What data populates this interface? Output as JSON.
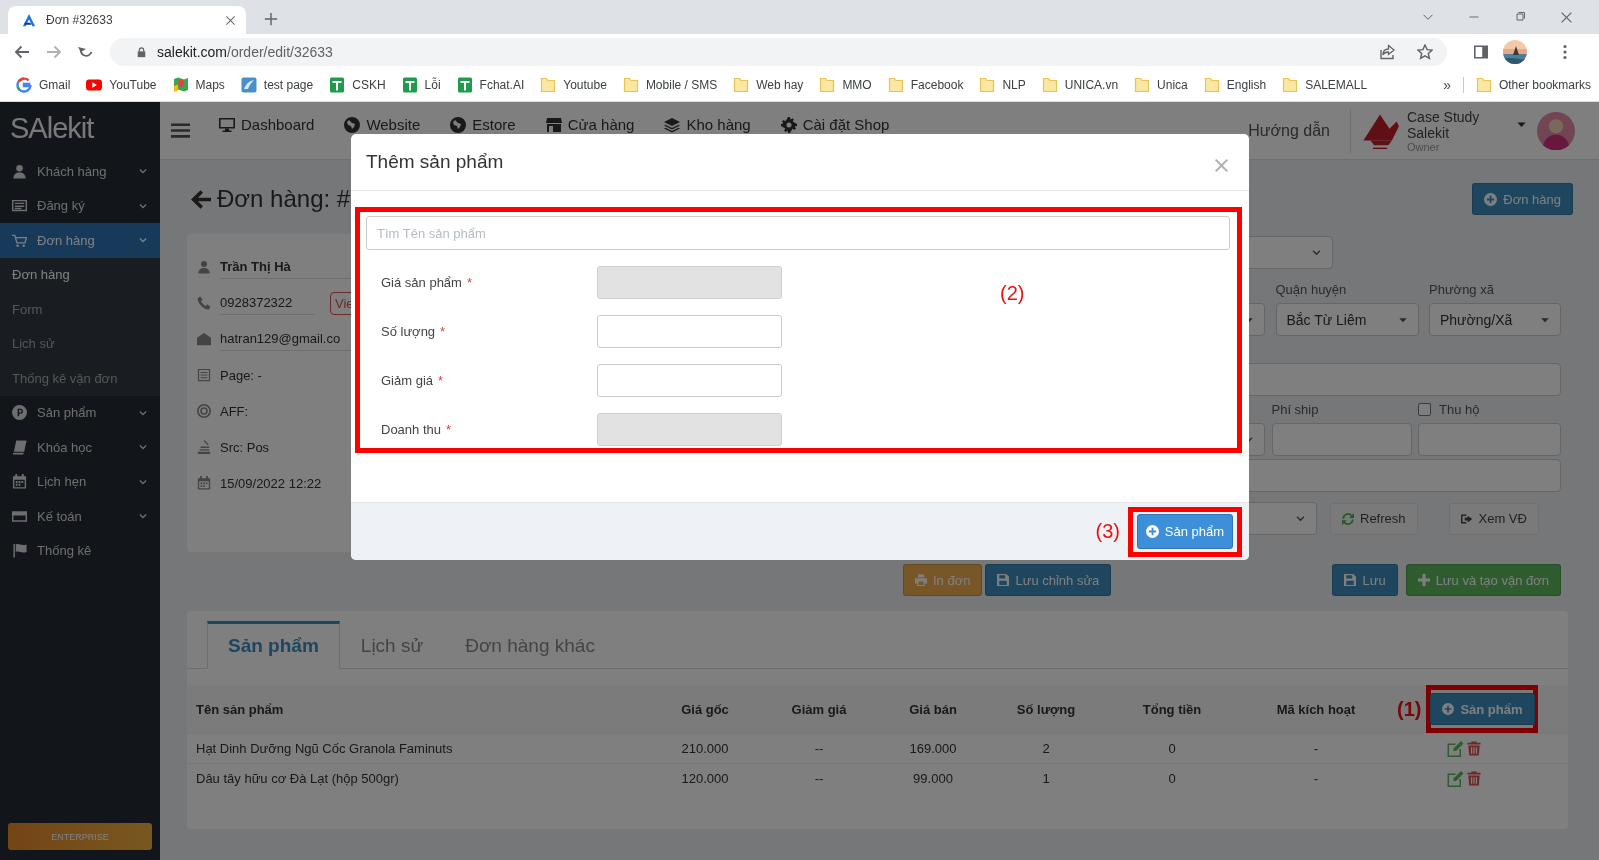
{
  "browser": {
    "tab_title": "Đơn #32633",
    "url_host": "salekit.com",
    "url_path": "/order/edit/32633",
    "bookmarks": [
      {
        "label": "Gmail",
        "kind": "gmail"
      },
      {
        "label": "YouTube",
        "kind": "youtube"
      },
      {
        "label": "Maps",
        "kind": "maps"
      },
      {
        "label": "test page",
        "kind": "site"
      },
      {
        "label": "CSKH",
        "kind": "sheet"
      },
      {
        "label": "Lỗi",
        "kind": "sheet"
      },
      {
        "label": "Fchat.AI",
        "kind": "sheet"
      },
      {
        "label": "Youtube",
        "kind": "folder"
      },
      {
        "label": "Mobile / SMS",
        "kind": "folder"
      },
      {
        "label": "Web hay",
        "kind": "folder"
      },
      {
        "label": "MMO",
        "kind": "folder"
      },
      {
        "label": "Facebook",
        "kind": "folder"
      },
      {
        "label": "NLP",
        "kind": "folder"
      },
      {
        "label": "UNICA.vn",
        "kind": "folder"
      },
      {
        "label": "Unica",
        "kind": "folder"
      },
      {
        "label": "English",
        "kind": "folder"
      },
      {
        "label": "SALEMALL",
        "kind": "folder"
      }
    ],
    "more": "»",
    "other_bookmarks": "Other bookmarks"
  },
  "sidebar": {
    "logo": "SAlekit",
    "items": [
      {
        "label": "Khách hàng",
        "kind": "group",
        "selected": false
      },
      {
        "label": "Đăng ký",
        "kind": "group",
        "selected": false
      },
      {
        "label": "Đơn hàng",
        "kind": "group",
        "selected": true,
        "children": [
          {
            "label": "Đơn hàng",
            "selected": true
          },
          {
            "label": "Form",
            "selected": false
          },
          {
            "label": "Lịch sử",
            "selected": false
          },
          {
            "label": "Thống kê vận đơn",
            "selected": false
          }
        ]
      },
      {
        "label": "Sản phẩm",
        "kind": "group",
        "selected": false
      },
      {
        "label": "Khóa học",
        "kind": "group",
        "selected": false
      },
      {
        "label": "Lịch hẹn",
        "kind": "group",
        "selected": false
      },
      {
        "label": "Kế toán",
        "kind": "group",
        "selected": false
      },
      {
        "label": "Thống kê",
        "kind": "link",
        "selected": false
      }
    ],
    "plan": "ENTERPRISE"
  },
  "topbar": {
    "nav": [
      "Dashboard",
      "Website",
      "Estore",
      "Cửa hàng",
      "Kho hàng",
      "Cài đặt Shop"
    ],
    "help": "Hướng dẫn",
    "account_name": "Case Study Salekit",
    "account_role": "Owner"
  },
  "order": {
    "title": "Đơn hàng: #",
    "new_order_button": "Đơn hàng",
    "customer": [
      {
        "kind": "name",
        "text": "Trần Thị Hà"
      },
      {
        "kind": "phone",
        "text": "0928372322",
        "tag": "Vie"
      },
      {
        "kind": "email",
        "text": "hatran129@gmail.co"
      },
      {
        "kind": "page",
        "text": "Page: -"
      },
      {
        "kind": "aff",
        "text": "AFF:"
      },
      {
        "kind": "source",
        "text": "Src: Pos"
      },
      {
        "kind": "date",
        "text": "15/09/2022 12:22"
      }
    ],
    "shipping": {
      "district_label": "Quận huyện",
      "district_value": "Bắc Từ Liêm",
      "ward_label": "Phường xã",
      "ward_value": "Phường/Xã",
      "fee_label": "Phí ship",
      "cod_label": "Thu hộ",
      "cod_checked": false,
      "refresh_button": "Refresh",
      "track_button": "Xem VĐ"
    },
    "actions": {
      "print": "In đơn",
      "save_edit": "Lưu chỉnh sửa",
      "save": "Lưu",
      "save_ship": "Lưu và tạo vận đơn"
    }
  },
  "tabs": [
    {
      "label": "Sản phẩm",
      "selected": true
    },
    {
      "label": "Lịch sử",
      "selected": false
    },
    {
      "label": "Đơn hàng khác",
      "selected": false
    }
  ],
  "table": {
    "columns": [
      "Tên sản phẩm",
      "Giá gốc",
      "Giảm giá",
      "Giá bán",
      "Số lượng",
      "Tổng tiền",
      "Mã kích hoạt"
    ],
    "rows": [
      {
        "cells": [
          "Hạt Dinh Dưỡng Ngũ Cốc Granola Faminuts",
          "210.000",
          "--",
          "169.000",
          "2",
          "0",
          "-"
        ]
      },
      {
        "cells": [
          "Dâu tây hữu cơ Đà Lạt (hộp 500gr)",
          "120.000",
          "--",
          "99.000",
          "1",
          "0",
          "-"
        ]
      }
    ],
    "annotation": "(1)",
    "add_button": "Sản phẩm"
  },
  "modal": {
    "title": "Thêm sản phẩm",
    "search_placeholder": "Tìm Tên sản phẩm",
    "fields": [
      {
        "label": "Giá sản phẩm",
        "required_mark": "*",
        "disabled": true
      },
      {
        "label": "Số lượng",
        "required_mark": "*",
        "disabled": false
      },
      {
        "label": "Giảm giá",
        "required_mark": "*",
        "disabled": false
      },
      {
        "label": "Doanh thu",
        "required_mark": "*",
        "disabled": true
      }
    ],
    "body_annotation": "(2)",
    "footer_annotation": "(3)",
    "submit_button": "Sản phẩm"
  }
}
